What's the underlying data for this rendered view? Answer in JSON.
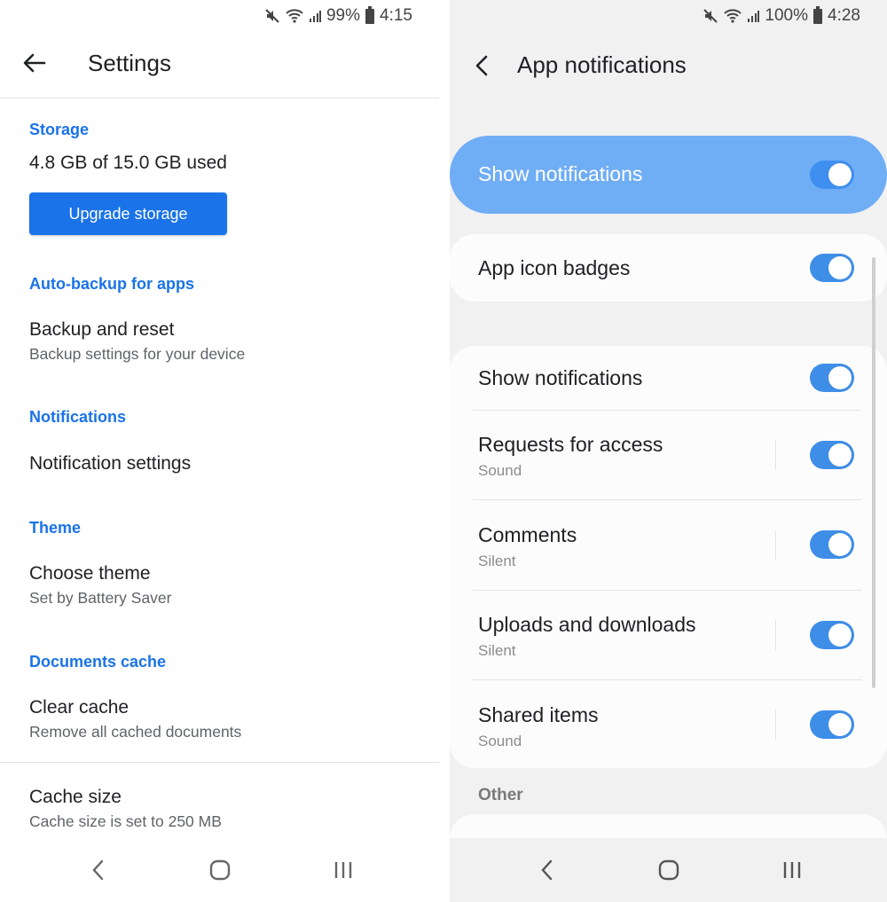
{
  "left": {
    "status": {
      "battery": "99%",
      "time": "4:15"
    },
    "appbar": {
      "title": "Settings",
      "back_icon": "arrow-left-icon"
    },
    "sections": {
      "storage": {
        "header": "Storage",
        "usage": "4.8 GB of 15.0 GB used",
        "button": "Upgrade storage"
      },
      "backup": {
        "header": "Auto-backup for apps",
        "title": "Backup and reset",
        "subtitle": "Backup settings for your device"
      },
      "notifications": {
        "header": "Notifications",
        "title": "Notification settings"
      },
      "theme": {
        "header": "Theme",
        "title": "Choose theme",
        "subtitle": "Set by Battery Saver"
      },
      "documents": {
        "header": "Documents cache",
        "title": "Clear cache",
        "subtitle": "Remove all cached documents"
      },
      "cache_size": {
        "title": "Cache size",
        "subtitle": "Cache size is set to 250 MB"
      }
    },
    "navbar": [
      "back-nav-icon",
      "home-nav-icon",
      "recents-nav-icon"
    ]
  },
  "right": {
    "status": {
      "battery": "100%",
      "time": "4:28"
    },
    "appbar": {
      "title": "App notifications",
      "back_icon": "chevron-left-icon"
    },
    "master_toggle": {
      "label": "Show notifications",
      "on": true
    },
    "badges": {
      "label": "App icon badges",
      "on": true
    },
    "categories": [
      {
        "label": "Show notifications",
        "subtitle": "",
        "on": true
      },
      {
        "label": "Requests for access",
        "subtitle": "Sound",
        "on": true
      },
      {
        "label": "Comments",
        "subtitle": "Silent",
        "on": true
      },
      {
        "label": "Uploads and downloads",
        "subtitle": "Silent",
        "on": true
      },
      {
        "label": "Shared items",
        "subtitle": "Sound",
        "on": true
      }
    ],
    "other_header": "Other",
    "navbar": [
      "back-nav-icon",
      "home-nav-icon",
      "recents-nav-icon"
    ]
  },
  "colors": {
    "accent": "#1a73e8",
    "toggle_on": "#3e8ee8",
    "master_bg": "#6fadf5"
  }
}
